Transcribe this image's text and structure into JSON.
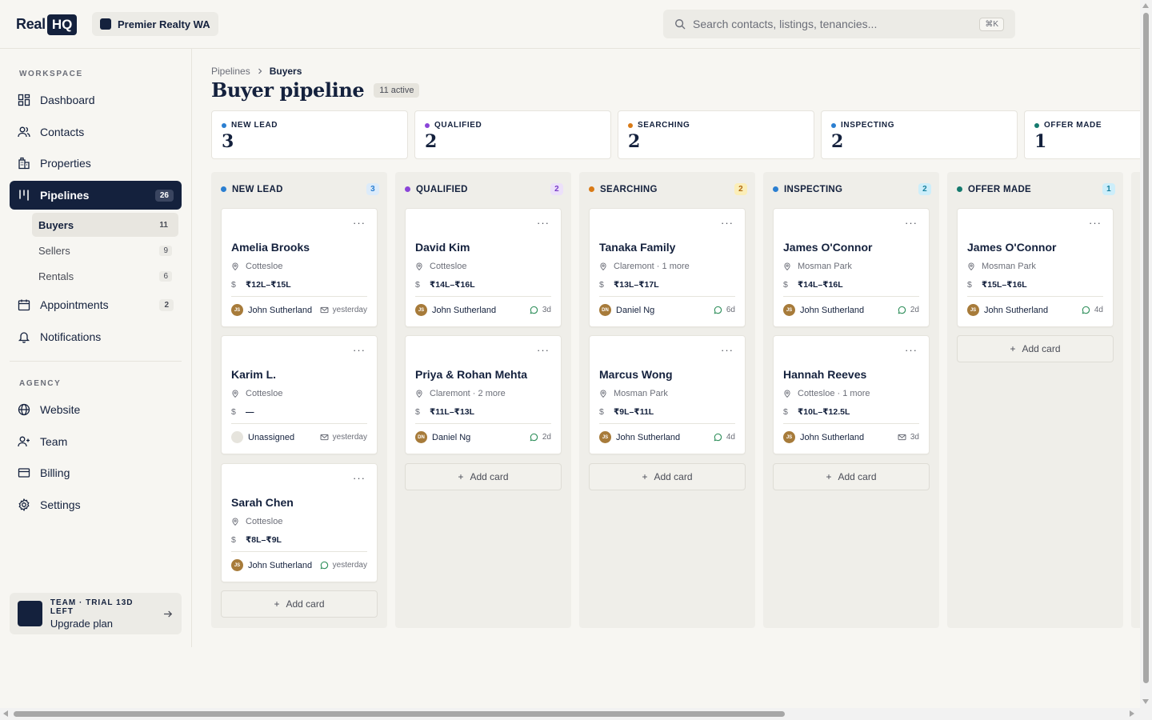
{
  "brand": {
    "real": "Real",
    "hq": "HQ"
  },
  "org": {
    "name": "Premier Realty WA"
  },
  "search": {
    "placeholder": "Search contacts, listings, tenancies...",
    "shortcut": "⌘K"
  },
  "sidebar": {
    "workspace_label": "WORKSPACE",
    "agency_label": "AGENCY",
    "items": [
      {
        "label": "Dashboard",
        "icon": "dashboard-icon"
      },
      {
        "label": "Contacts",
        "icon": "users-icon"
      },
      {
        "label": "Properties",
        "icon": "building-icon"
      },
      {
        "label": "Pipelines",
        "icon": "pipeline-icon",
        "badge": "26"
      },
      {
        "label": "Appointments",
        "icon": "calendar-icon",
        "badge": "2"
      },
      {
        "label": "Notifications",
        "icon": "bell-icon"
      }
    ],
    "sub": [
      {
        "label": "Buyers",
        "count": "11"
      },
      {
        "label": "Sellers",
        "count": "9"
      },
      {
        "label": "Rentals",
        "count": "6"
      }
    ],
    "agency": [
      {
        "label": "Website",
        "icon": "globe-icon"
      },
      {
        "label": "Team",
        "icon": "team-icon"
      },
      {
        "label": "Billing",
        "icon": "card-icon"
      },
      {
        "label": "Settings",
        "icon": "gear-icon"
      }
    ],
    "trial": {
      "line1": "TEAM · TRIAL 13D LEFT",
      "line2": "Upgrade plan"
    }
  },
  "breadcrumb": {
    "parent": "Pipelines",
    "current": "Buyers"
  },
  "page": {
    "title": "Buyer pipeline",
    "active": "11 active"
  },
  "colors": {
    "new": "#2b7fd1",
    "qualified": "#8a45d8",
    "searching": "#d97a16",
    "inspecting": "#2b7fd1",
    "offer": "#157a6e"
  },
  "stats": [
    {
      "label": "NEW LEAD",
      "value": "3"
    },
    {
      "label": "QUALIFIED",
      "value": "2"
    },
    {
      "label": "SEARCHING",
      "value": "2"
    },
    {
      "label": "INSPECTING",
      "value": "2"
    },
    {
      "label": "OFFER MADE",
      "value": "1"
    }
  ],
  "add_card_label": "Add card",
  "columns": [
    {
      "title": "NEW LEAD",
      "count": "3",
      "cards": [
        {
          "name": "Amelia Brooks",
          "location": "Cottesloe",
          "price": "₹12L–₹15L",
          "agent": "John Sutherland",
          "initials": "JS",
          "meta": "yesterday",
          "meta_icon": "mail"
        },
        {
          "name": "Karim L.",
          "location": "Cottesloe",
          "price": "—",
          "agent": "Unassigned",
          "initials": "",
          "meta": "yesterday",
          "meta_icon": "mail"
        },
        {
          "name": "Sarah Chen",
          "location": "Cottesloe",
          "price": "₹8L–₹9L",
          "agent": "John Sutherland",
          "initials": "JS",
          "meta": "yesterday",
          "meta_icon": "chat"
        }
      ]
    },
    {
      "title": "QUALIFIED",
      "count": "2",
      "cards": [
        {
          "name": "David Kim",
          "location": "Cottesloe",
          "price": "₹14L–₹16L",
          "agent": "John Sutherland",
          "initials": "JS",
          "meta": "3d",
          "meta_icon": "chat"
        },
        {
          "name": "Priya & Rohan Mehta",
          "location": "Claremont · 2 more",
          "price": "₹11L–₹13L",
          "agent": "Daniel Ng",
          "initials": "DN",
          "meta": "2d",
          "meta_icon": "chat"
        }
      ]
    },
    {
      "title": "SEARCHING",
      "count": "2",
      "cards": [
        {
          "name": "Tanaka Family",
          "location": "Claremont · 1 more",
          "price": "₹13L–₹17L",
          "agent": "Daniel Ng",
          "initials": "DN",
          "meta": "6d",
          "meta_icon": "chat"
        },
        {
          "name": "Marcus Wong",
          "location": "Mosman Park",
          "price": "₹9L–₹11L",
          "agent": "John Sutherland",
          "initials": "JS",
          "meta": "4d",
          "meta_icon": "chat"
        }
      ]
    },
    {
      "title": "INSPECTING",
      "count": "2",
      "cards": [
        {
          "name": "James O'Connor",
          "location": "Mosman Park",
          "price": "₹14L–₹16L",
          "agent": "John Sutherland",
          "initials": "JS",
          "meta": "2d",
          "meta_icon": "chat"
        },
        {
          "name": "Hannah Reeves",
          "location": "Cottesloe · 1 more",
          "price": "₹10L–₹12.5L",
          "agent": "John Sutherland",
          "initials": "JS",
          "meta": "3d",
          "meta_icon": "mail"
        }
      ]
    },
    {
      "title": "OFFER MADE",
      "count": "1",
      "cards": [
        {
          "name": "James O'Connor",
          "location": "Mosman Park",
          "price": "₹15L–₹16L",
          "agent": "John Sutherland",
          "initials": "JS",
          "meta": "4d",
          "meta_icon": "chat"
        }
      ]
    }
  ]
}
